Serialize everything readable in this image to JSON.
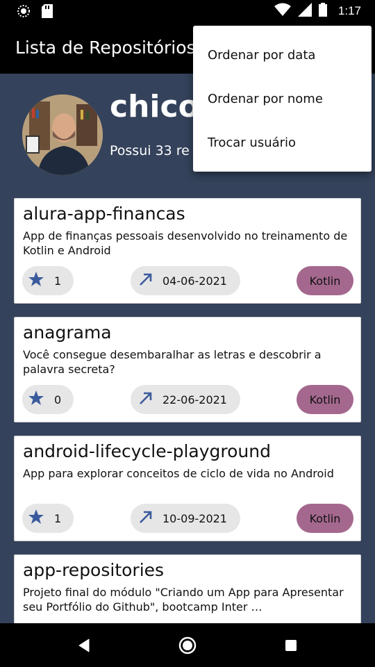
{
  "status_bar": {
    "time": "1:17"
  },
  "app_bar": {
    "title": "Lista de Repositórios"
  },
  "profile": {
    "username": "chicom",
    "repo_count_text": "Possui 33 re"
  },
  "menu": {
    "items": [
      {
        "label": "Ordenar por data"
      },
      {
        "label": "Ordenar por nome"
      },
      {
        "label": "Trocar usuário"
      }
    ]
  },
  "repositories": [
    {
      "name": "alura-app-financas",
      "description": "App de finanças pessoais desenvolvido no treinamento de Kotlin e Android",
      "stars": "1",
      "date": "04-06-2021",
      "language": "Kotlin"
    },
    {
      "name": "anagrama",
      "description": "Você consegue desembaralhar as letras e descobrir a palavra secreta?",
      "stars": "0",
      "date": "22-06-2021",
      "language": "Kotlin"
    },
    {
      "name": "android-lifecycle-playground",
      "description": "App para explorar conceitos de ciclo de vida no Android",
      "stars": "1",
      "date": "10-09-2021",
      "language": "Kotlin"
    },
    {
      "name": "app-repositories",
      "description": "Projeto final do módulo \"Criando um App para Apresentar seu Portfólio do Github\", bootcamp Inter …",
      "stars": "",
      "date": "",
      "language": ""
    }
  ],
  "colors": {
    "background": "#34425b",
    "language_chip": "#a4688e",
    "star_icon": "#3a5a9c",
    "chip": "#e6e6e6"
  },
  "icons": [
    "wifi-icon",
    "signal-icon",
    "battery-icon",
    "star-icon",
    "arrow-up-right-icon",
    "back-icon",
    "home-icon",
    "recents-icon"
  ]
}
